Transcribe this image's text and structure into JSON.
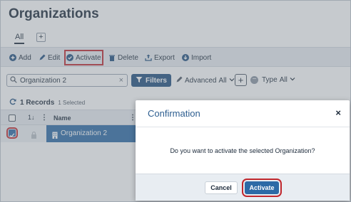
{
  "page": {
    "title": "Organizations"
  },
  "tabs": {
    "items": [
      {
        "label": "All"
      }
    ],
    "add_label": "+"
  },
  "toolbar": {
    "add": "Add",
    "edit": "Edit",
    "activate": "Activate",
    "delete": "Delete",
    "export": "Export",
    "import": "Import"
  },
  "search": {
    "value": "Organization 2",
    "clear": "×"
  },
  "filters": {
    "label": "Filters",
    "advanced_label": "Advanced",
    "advanced_value": "All",
    "type_label": "Type",
    "type_value": "All"
  },
  "records": {
    "count_text": "1 Records",
    "selected_text": "1 Selected"
  },
  "grid": {
    "columns": {
      "sort": "1",
      "name": "Name"
    },
    "rows": [
      {
        "name": "Organization 2",
        "selected": true
      }
    ]
  },
  "modal": {
    "title": "Confirmation",
    "message": "Do you want to activate the selected Organization?",
    "cancel_label": "Cancel",
    "confirm_label": "Activate"
  },
  "colors": {
    "primary": "#2c6aa6",
    "highlight": "#c0272d",
    "title_blue": "#2c5d8f"
  },
  "icons": [
    "plus-circle-icon",
    "pencil-icon",
    "check-circle-icon",
    "trash-icon",
    "export-icon",
    "import-icon",
    "search-icon",
    "filter-icon",
    "refresh-icon",
    "building-icon",
    "close-icon"
  ]
}
